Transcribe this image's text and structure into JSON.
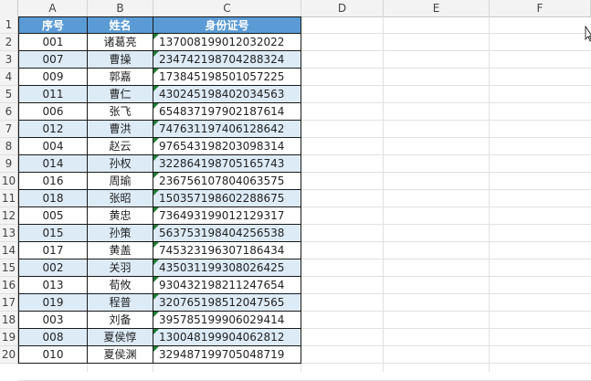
{
  "columns": [
    "A",
    "B",
    "C",
    "D",
    "E",
    "F"
  ],
  "rows": [
    "1",
    "2",
    "3",
    "4",
    "5",
    "6",
    "7",
    "8",
    "9",
    "10",
    "11",
    "12",
    "13",
    "14",
    "15",
    "16",
    "17",
    "18",
    "19",
    "20"
  ],
  "headers": {
    "a": "序号",
    "b": "姓名",
    "c": "身份证号"
  },
  "records": [
    {
      "a": "001",
      "b": "诸葛亮",
      "c": "137008199012032022"
    },
    {
      "a": "007",
      "b": "曹操",
      "c": "234742198704288324"
    },
    {
      "a": "009",
      "b": "郭嘉",
      "c": "173845198501057225"
    },
    {
      "a": "011",
      "b": "曹仁",
      "c": "430245198402034563"
    },
    {
      "a": "006",
      "b": "张飞",
      "c": "654837197902187614"
    },
    {
      "a": "012",
      "b": "曹洪",
      "c": "747631197406128642"
    },
    {
      "a": "004",
      "b": "赵云",
      "c": "976543198203098314"
    },
    {
      "a": "014",
      "b": "孙权",
      "c": "322864198705165743"
    },
    {
      "a": "016",
      "b": "周瑜",
      "c": "236756107804063575"
    },
    {
      "a": "018",
      "b": "张昭",
      "c": "150357198602288675"
    },
    {
      "a": "005",
      "b": "黄忠",
      "c": "736493199012129317"
    },
    {
      "a": "015",
      "b": "孙策",
      "c": "563753198404256538"
    },
    {
      "a": "017",
      "b": "黄盖",
      "c": "745323196307186434"
    },
    {
      "a": "002",
      "b": "关羽",
      "c": "435031199308026425"
    },
    {
      "a": "013",
      "b": "荀攸",
      "c": "930432198211247654"
    },
    {
      "a": "019",
      "b": "程普",
      "c": "320765198512047565"
    },
    {
      "a": "003",
      "b": "刘备",
      "c": "395785199906029414"
    },
    {
      "a": "008",
      "b": "夏侯惇",
      "c": "130048199904062812"
    },
    {
      "a": "010",
      "b": "夏侯渊",
      "c": "329487199705048719"
    }
  ],
  "colors": {
    "header_fill": "#5b9bd5",
    "band_fill": "#ddebf7",
    "text_marker": "#1e7d34"
  },
  "icons": {
    "cursor": "mouse-cursor-icon",
    "text_marker": "number-stored-as-text-icon"
  }
}
